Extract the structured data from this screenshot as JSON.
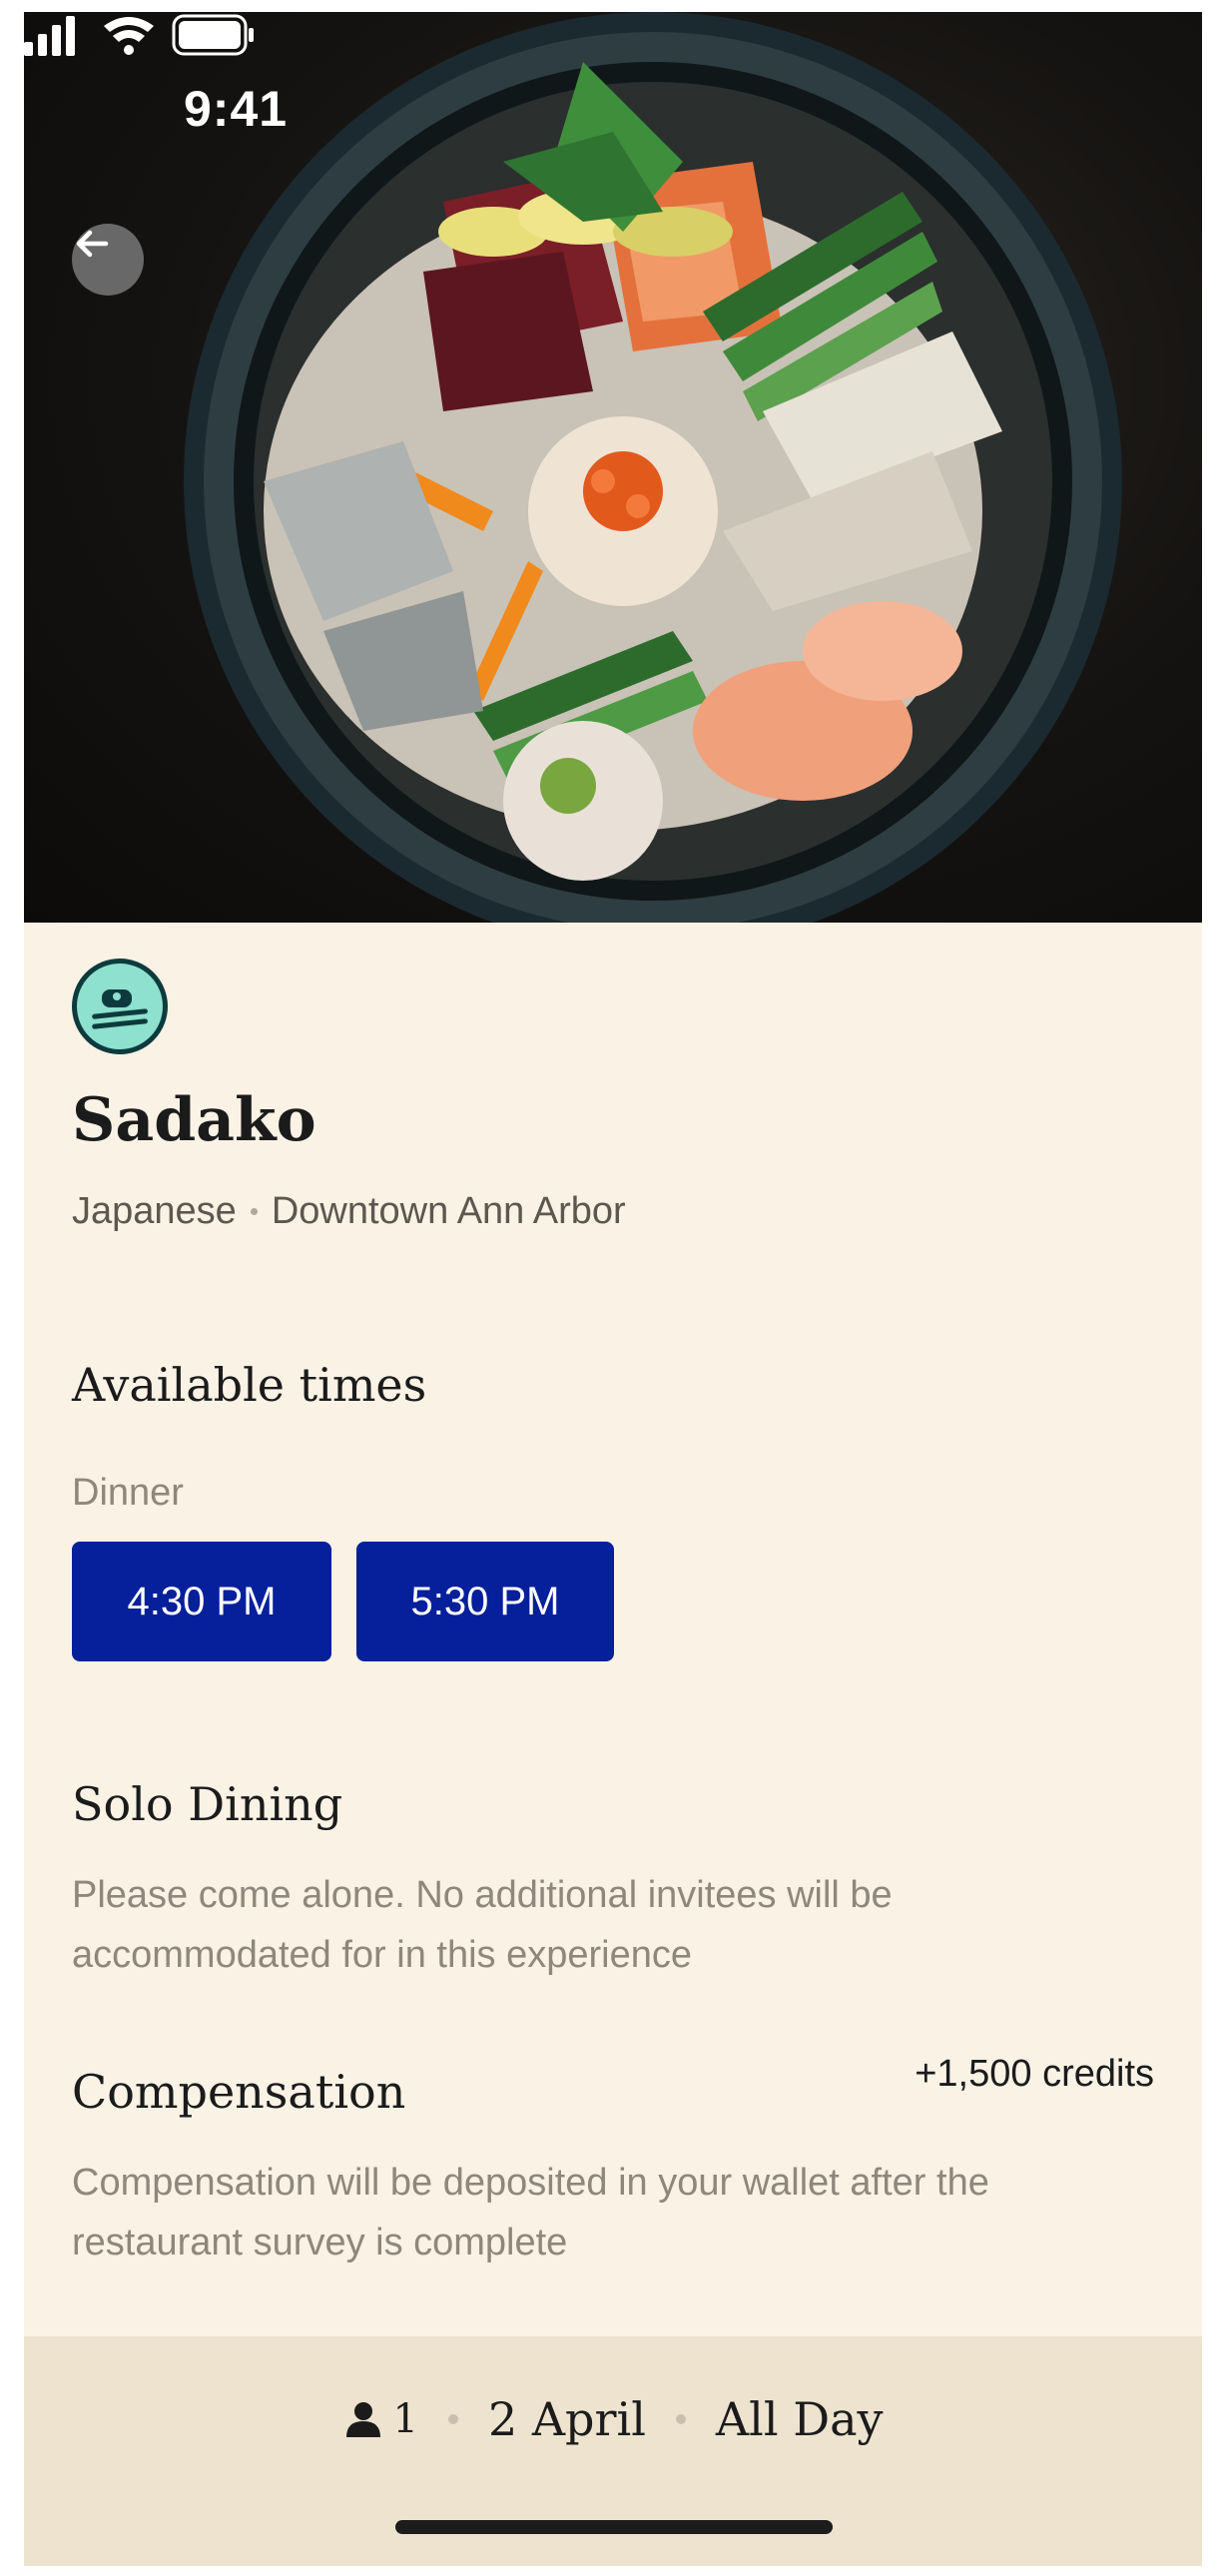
{
  "status_bar": {
    "time": "9:41",
    "icons": [
      "signal-icon",
      "wifi-icon",
      "battery-icon"
    ]
  },
  "header": {
    "back_icon": "arrow-left-icon"
  },
  "hero": {
    "image": "sashimi-bowl-photo"
  },
  "restaurant": {
    "badge_icon": "sushi-icon",
    "name": "Sadako",
    "cuisine": "Japanese",
    "location": "Downtown Ann Arbor"
  },
  "available_times": {
    "heading": "Available times",
    "meal": "Dinner",
    "slots": [
      "4:30 PM",
      "5:30 PM"
    ]
  },
  "solo_dining": {
    "heading": "Solo Dining",
    "description": "Please come alone. No additional invitees will be accommodated for in this experience"
  },
  "compensation": {
    "heading": "Compensation",
    "amount": "+1,500 credits",
    "description": "Compensation will be deposited in your wallet after the restaurant survey is complete"
  },
  "booking_bar": {
    "guest_icon": "person-icon",
    "guests": "1",
    "date": "2 April",
    "time": "All Day"
  },
  "colors": {
    "background": "#faf2e5",
    "button": "#061f9b",
    "badge": "#8ee0cf",
    "bottom_bar": "#ede3cf"
  }
}
